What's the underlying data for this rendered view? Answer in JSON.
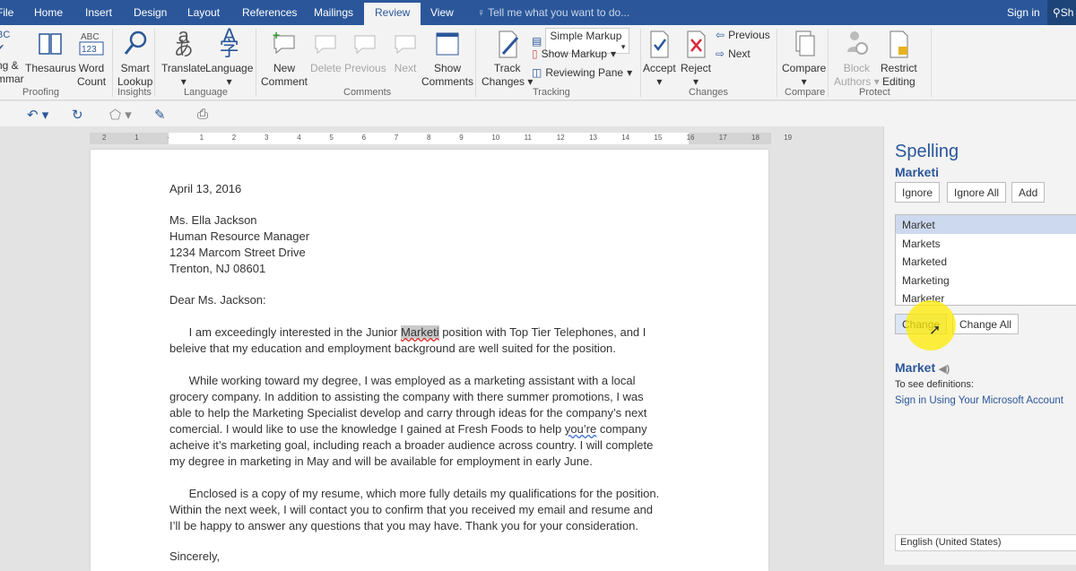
{
  "tabs": [
    "File",
    "Home",
    "Insert",
    "Design",
    "Layout",
    "References",
    "Mailings",
    "Review",
    "View"
  ],
  "active_tab": "Review",
  "tell_me": "Tell me what you want to do...",
  "sign_in": "Sign in",
  "share": "Sh",
  "ribbon": {
    "spelling": "ng &\nmmar",
    "thesaurus": "Thesaurus",
    "word_count_1": "Word",
    "word_count_2": "Count",
    "smart_1": "Smart",
    "smart_2": "Lookup",
    "translate": "Translate",
    "language": "Language",
    "new_comment_1": "New",
    "new_comment_2": "Comment",
    "delete": "Delete",
    "previous": "Previous",
    "next": "Next",
    "show_comments_1": "Show",
    "show_comments_2": "Comments",
    "track_1": "Track",
    "track_2": "Changes",
    "markup_select": "Simple Markup",
    "show_markup": "Show Markup",
    "reviewing_pane": "Reviewing Pane",
    "accept": "Accept",
    "reject": "Reject",
    "prev_change": "Previous",
    "next_change": "Next",
    "compare": "Compare",
    "block_1": "Block",
    "block_2": "Authors",
    "restrict_1": "Restrict",
    "restrict_2": "Editing",
    "groups": {
      "proofing": "Proofing",
      "insights": "Insights",
      "language": "Language",
      "comments": "Comments",
      "tracking": "Tracking",
      "changes": "Changes",
      "compare": "Compare",
      "protect": "Protect"
    }
  },
  "ruler": [
    "2",
    "1",
    "·",
    "1",
    "2",
    "3",
    "4",
    "5",
    "6",
    "7",
    "8",
    "9",
    "10",
    "11",
    "12",
    "13",
    "14",
    "15",
    "16",
    "17",
    "18",
    "19"
  ],
  "document": {
    "date": "April 13, 2016",
    "addr": [
      "Ms. Ella Jackson",
      "Human Resource Manager",
      "1234 Marcom Street Drive",
      "Trenton, NJ 08601"
    ],
    "greeting": "Dear Ms. Jackson:",
    "p1a": "      I am exceedingly interested in the Junior ",
    "p1word": "Marketi",
    "p1b": " position with Top Tier Telephones, and I",
    "p1c": "beleive that my education and employment background are well suited for the position.",
    "p2": [
      "      While working toward my degree, I was employed as a marketing assistant with a local",
      "grocery company. In addition to assisting the company with there summer promotions, I was",
      "able to help the Marketing Specialist develop and carry through ideas for the company’s next",
      "comercial. I would like to use the knowledge I gained at Fresh Foods to help "
    ],
    "p2word": "you’re",
    "p2c": " company",
    "p2rest": [
      "acheive it’s marketing goal, including reach a broader audience across country. I will complete",
      "my degree in marketing in May and will be available for employment in early June."
    ],
    "p3": [
      "      Enclosed is a copy of my resume, which more fully details my qualifications for the position.",
      "Within the next week, I will contact you to confirm that you received my email and resume and",
      "I’ll be happy to answer any questions that you may have. Thank you for your consideration."
    ],
    "closing": "Sincerely,"
  },
  "pane": {
    "title": "Spelling",
    "word": "Marketi",
    "ignore": "Ignore",
    "ignore_all": "Ignore All",
    "add": "Add",
    "suggestions": [
      "Market",
      "Markets",
      "Marketed",
      "Marketing",
      "Marketer"
    ],
    "change": "Change",
    "change_all": "Change All",
    "def_word": "Market",
    "def_label": "To see definitions:",
    "sign_in_link": "Sign in Using Your Microsoft Account",
    "language": "English (United States)"
  }
}
